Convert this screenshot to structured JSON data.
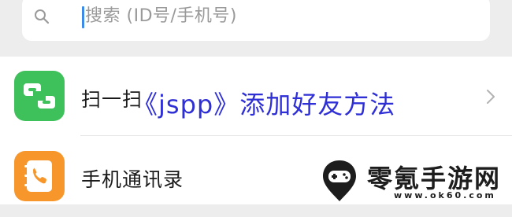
{
  "search": {
    "placeholder": "搜索 (ID号/手机号)"
  },
  "list": {
    "items": [
      {
        "label": "扫一扫",
        "icon": "scan-icon",
        "color": "#3ec15b"
      },
      {
        "label": "手机通讯录",
        "icon": "contacts-book-icon",
        "color": "#f7962a"
      }
    ]
  },
  "overlay": {
    "title": "《jspp》添加好友方法"
  },
  "watermark": {
    "name": "零氪手游网",
    "url": "www.ok60.com",
    "icon": "gamepad-pin-icon"
  },
  "colors": {
    "accent": "#3c8ce7",
    "overlay_text": "#2f2fd6"
  }
}
